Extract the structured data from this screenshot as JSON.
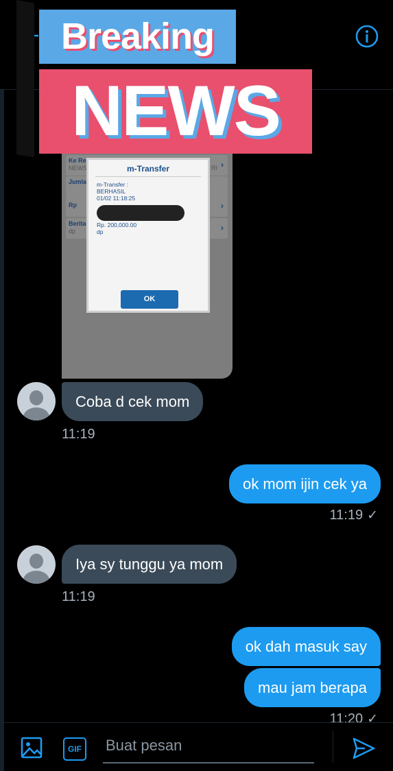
{
  "header": {
    "info_icon": "info-icon",
    "back_icon": "back-arrow-icon"
  },
  "overlay": {
    "breaking": "Breaking",
    "news": "NEWS",
    "colors": {
      "blue": "#5aa8e6",
      "pink": "#e8506e"
    }
  },
  "attachment": {
    "rows": [
      {
        "label": "Ke Re",
        "sub": "NEWS",
        "trail": "RI"
      },
      {
        "label": "Jumla",
        "sub": "",
        "trail": ""
      },
      {
        "label": "Rp",
        "sub": "",
        "trail": ""
      },
      {
        "label": "Berita",
        "sub": "dp",
        "trail": ""
      }
    ],
    "dialog": {
      "title": "m-Transfer",
      "line1": "m-Transfer :",
      "line2": "BERHASIL",
      "line3": "01/02 11:18:25",
      "amount": "Rp. 200,000.00",
      "note": "dp",
      "ok": "OK"
    }
  },
  "messages": [
    {
      "from": "them",
      "text": "Coba d cek mom",
      "time": "11:19"
    },
    {
      "from": "me",
      "text": "ok mom ijin cek ya",
      "time": "11:19"
    },
    {
      "from": "them",
      "text": "Iya sy tunggu ya mom",
      "time": "11:19"
    },
    {
      "from": "me",
      "text": "ok dah masuk say",
      "time": ""
    },
    {
      "from": "me",
      "text": "mau jam berapa",
      "time": "11:20"
    }
  ],
  "composer": {
    "placeholder": "Buat pesan",
    "gif_label": "GIF",
    "media_icon": "image-icon",
    "send_icon": "send-icon"
  },
  "colors": {
    "accent": "#1d9bf0",
    "incoming": "#3a4a58"
  }
}
